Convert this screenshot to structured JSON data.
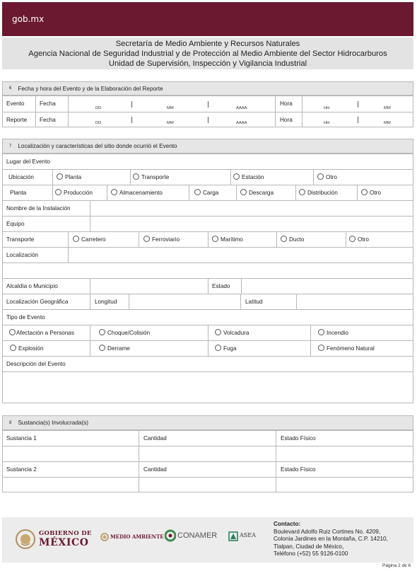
{
  "topbar": {
    "logo": "gob.mx"
  },
  "header": {
    "line1": "Secretaría de Medio Ambiente y Recursos Naturales",
    "line2": "Agencia Nacional de Seguridad Industrial y de Protección al Medio Ambiente del Sector Hidrocarburos",
    "line3": "Unidad de Supervisión, Inspección y Vigilancia Industrial"
  },
  "section6a": {
    "num": "6",
    "title": "Fecha y hora del Evento y de la Elaboración del Reporte",
    "row1_label": "Evento",
    "row2_label": "Reporte",
    "fecha": "Fecha",
    "hora": "Hora",
    "dd": "DD",
    "mm": "MM",
    "aaaa": "AAAA",
    "hh": "HH"
  },
  "section7": {
    "num": "7",
    "title": "Localización y características del sitio donde ocurrió el Evento",
    "lugar": "Lugar del Evento",
    "ubicacion": "Ubicación",
    "ubicacion_opts": [
      "Planta",
      "Transporte",
      "Estación",
      "Otro"
    ],
    "planta": "Planta",
    "planta_opts": [
      "Producción",
      "Almacenamiento",
      "Carga",
      "Descarga",
      "Distribución",
      "Otro"
    ],
    "nombre_instalacion": "Nombre de la Instalación",
    "equipo": "Equipo",
    "transporte": "Transporte",
    "transporte_opts": [
      "Carretero",
      "Ferroviario",
      "Marítimo",
      "Ducto",
      "Otro"
    ],
    "localizacion": "Localización",
    "alcaldia": "Alcaldía o Municipio",
    "estado": "Estado",
    "loc_geo": "Localización Geográfica",
    "longitud": "Longitud",
    "latitud": "Latitud",
    "tipo_evento": "Tipo de Evento",
    "tipo_opts": [
      "Afectación a Personas",
      "Choque/Colisión",
      "Volcadura",
      "Incendio",
      "Explosión",
      "Derrame",
      "Fuga",
      "Fenómeno Natural"
    ],
    "descripcion": "Descripción del Evento"
  },
  "section8": {
    "num": "8",
    "title": "Sustancia(s) Involucrada(s)",
    "sust1": "Sustancia 1",
    "sust2": "Sustancia 2",
    "cantidad": "Cantidad",
    "estado_fisico": "Estado Físico"
  },
  "footer": {
    "logo1_line1": "GOBIERNO DE",
    "logo1_line2": "MÉXICO",
    "logo2": "MEDIO AMBIENTE",
    "logo3": "CONAMER",
    "logo4": "ASEA",
    "contact_title": "Contacto:",
    "contact_lines": [
      "Boulevard Adolfo Ruiz Cortines No. 4209,",
      "Colonia Jardines en la Montaña, C.P. 14210,",
      "Tlalpan, Ciudad de México,",
      "Teléfono (+52) 55 9126-0100"
    ],
    "page": "Página 2 de 6"
  },
  "colors": {
    "brand": "#6b1930",
    "section_bg": "#e6e6e6",
    "border": "#b8b8b8"
  }
}
